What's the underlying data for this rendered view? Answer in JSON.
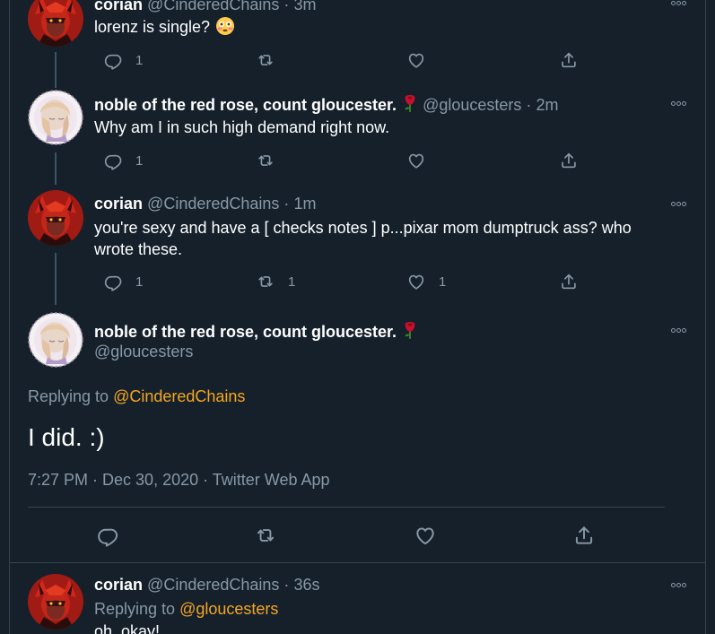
{
  "tweets": [
    {
      "name": "corian",
      "handle": "@CinderedChains",
      "dot": "·",
      "time": "3m",
      "text": "lorenz is single?",
      "reply_count": "1",
      "retweet_count": "",
      "like_count": ""
    },
    {
      "name": "noble of the red rose, count gloucester.",
      "handle": "@gloucesters",
      "dot": "·",
      "time": "2m",
      "text": "Why am I in such high demand right now.",
      "reply_count": "1",
      "retweet_count": "",
      "like_count": ""
    },
    {
      "name": "corian",
      "handle": "@CinderedChains",
      "dot": "·",
      "time": "1m",
      "text": "you're sexy and have a [ checks notes ] p...pixar mom dumptruck ass? who wrote these.",
      "reply_count": "1",
      "retweet_count": "1",
      "like_count": "1"
    }
  ],
  "focused": {
    "name": "noble of the red rose, count gloucester.",
    "handle": "@gloucesters",
    "replying_label": "Replying to",
    "replying_to": "@CinderedChains",
    "text": "I did. :)",
    "meta": "7:27 PM · Dec 30, 2020 · Twitter Web App"
  },
  "reply": {
    "name": "corian",
    "handle": "@CinderedChains",
    "dot": "·",
    "time": "36s",
    "replying_label": "Replying to",
    "replying_to": "@gloucesters",
    "text": "oh, okay!"
  },
  "colors": {
    "background": "#15202b",
    "secondary_text": "#8899a6",
    "link": "#f5a623",
    "border": "#38444d"
  },
  "icons": [
    "reply-icon",
    "retweet-icon",
    "like-icon",
    "share-icon",
    "more-icon",
    "rose-emoji",
    "flushed-emoji"
  ]
}
